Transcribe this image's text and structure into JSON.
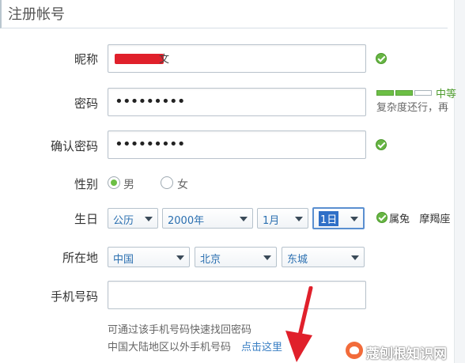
{
  "header": {
    "title": "注册帐号"
  },
  "form": {
    "nickname": {
      "label": "昵称",
      "value_tail": "文"
    },
    "password": {
      "label": "密码",
      "value": "•••••••••"
    },
    "confirm": {
      "label": "确认密码",
      "value": "•••••••••"
    },
    "gender": {
      "label": "性别",
      "options": [
        "男",
        "女"
      ],
      "selected": "男"
    },
    "birthday": {
      "label": "生日",
      "calendar": "公历",
      "year": "2000年",
      "month": "1月",
      "day": "1日",
      "zodiac": "属兔",
      "constellation": "摩羯座"
    },
    "location": {
      "label": "所在地",
      "country": "中国",
      "province": "北京",
      "district": "东城"
    },
    "phone": {
      "label": "手机号码",
      "value": ""
    }
  },
  "password_strength": {
    "level_text": "中等",
    "filled_segments": 2,
    "total_segments": 3,
    "hint": "复杂度还行，再"
  },
  "tips": {
    "line1": "可通过该手机号码快速找回密码",
    "line2": "中国大陆地区以外手机号码",
    "link": "点击这里"
  },
  "watermark": {
    "text": "蔻刨根知识网"
  },
  "colors": {
    "ok_green": "#67b544",
    "link_blue": "#3a7fc4",
    "annotation_red": "#e0202b"
  }
}
